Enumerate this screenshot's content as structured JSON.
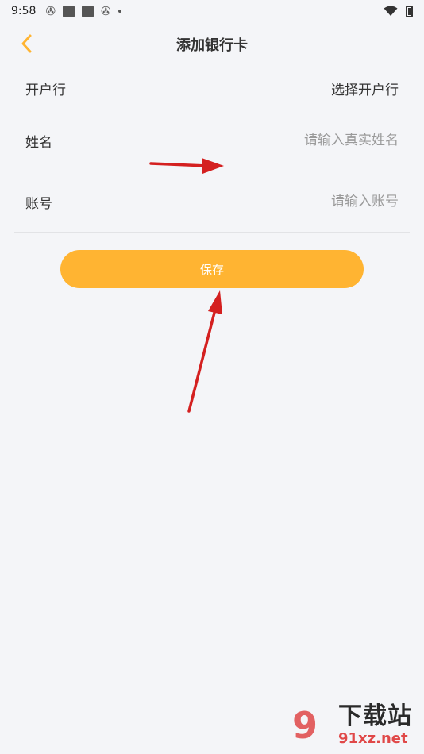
{
  "status_bar": {
    "time": "9:58"
  },
  "nav": {
    "title": "添加银行卡"
  },
  "form": {
    "bank": {
      "label": "开户行",
      "value": "选择开户行"
    },
    "name": {
      "label": "姓名",
      "placeholder": "请输入真实姓名"
    },
    "account": {
      "label": "账号",
      "placeholder": "请输入账号"
    }
  },
  "save_label": "保存",
  "colors": {
    "accent": "#ffb432",
    "background": "#f4f5f8",
    "arrow": "#d42020"
  },
  "watermark": {
    "cn": "下载站",
    "en": "91xz.net"
  }
}
